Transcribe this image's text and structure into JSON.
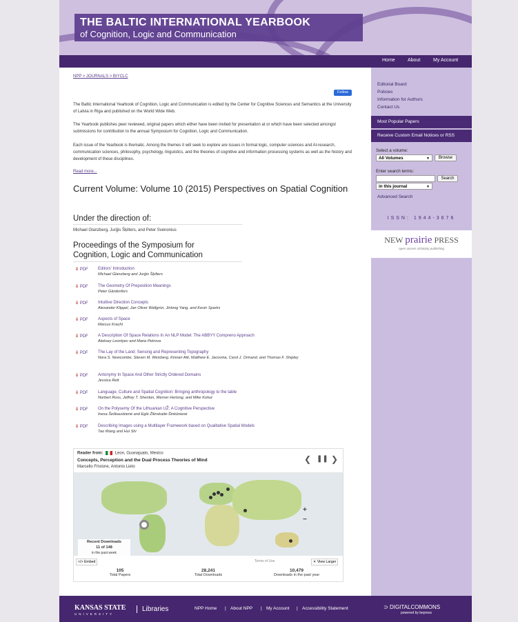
{
  "banner": {
    "title_line1": "THE BALTIC INTERNATIONAL YEARBOOK",
    "title_line2": "of Cognition, Logic and Communication"
  },
  "topnav": {
    "home": "Home",
    "about": "About",
    "account": "My Account"
  },
  "breadcrumb": "NPP > JOURNALS > BIYCLC",
  "follow_label": "Follow",
  "intro": {
    "p1": "The Baltic International Yearbook of Cognition, Logic and Communication is edited by the Center for Cognitive Sciences and Semantics at the University of Latvia in Riga and published on the World Wide Web.",
    "p2": "The Yearbook publishes peer reviewed, original papers which either have been invited for presentation at or which have been selected amongst submissions for contribution to the annual Symposium for Cognition, Logic and Communication.",
    "p3": "Each issue of the Yearbook is thematic. Among the themes it will seek to explore are issues in formal logic, computer sciences and AI-research, communication sciences, philosophy, psychology, linguistics, and the theories of cognitive and information processing systems as well as the history and development of these disciplines.",
    "read_more": "Read more..."
  },
  "current_volume": "Current Volume: Volume 10 (2015) Perspectives on Spatial Cognition",
  "direction_heading": "Under the direction of:",
  "editors": "Michael Glanzberg, Jurģis Šķilters, and Peter Svenonius",
  "proceedings_heading": "Proceedings of the Symposium for Cognition, Logic and Communication",
  "pdf_label": "PDF",
  "papers": [
    {
      "title": "Editors' Introduction",
      "authors": "Michael Glanzberg and Jurģis Šķilters"
    },
    {
      "title": "The Geometry Of Preposition Meanings",
      "authors": "Peter Gärdenfors"
    },
    {
      "title": "Intuitive Direction Concepts",
      "authors": "Alexander Klippel, Jan Oliver Wallgrün, Jinlong Yang, and Kevin Sparks"
    },
    {
      "title": "Aspects of Space",
      "authors": "Marcus Kracht"
    },
    {
      "title": "A Description Of Space Relations In An NLP Model: The ABBYY Compreno Approach",
      "authors": "Aleksey Leontyev and Maria Petrova"
    },
    {
      "title": "The Lay of the Land: Sensing and Representing Topography",
      "authors": "Nora S. Newcombe, Steven M. Weisberg, Kinnari Atit, Matthew E. Jacovina, Carol J. Ormand, and Thomas F. Shipley"
    },
    {
      "title": "Antonymy In Space And Other Strictly Ordered Domains",
      "authors": "Jessica Rett"
    },
    {
      "title": "Language, Culture and Spatial Cognition: Bringing anthropology to the table",
      "authors": "Norbert Ross, Jeffrey T. Shenton, Werner Hertzog, and Mike Kohut"
    },
    {
      "title": "On the Polysemy Of the Lithuanian UŽ: A Cognitive Perspective",
      "authors": "Inesa Šeškauskienė and Eglė Žilinskaitė-Šinkūnienė"
    },
    {
      "title": "Describing Images using a Multilayer Framework based on Qualitative Spatial Models",
      "authors": "Tao Wang and Hui Shi"
    }
  ],
  "widget": {
    "reader_label": "Reader from:",
    "reader_location": "Leon, Guanajuato, Mexico",
    "current_title": "Concepts, Perception and the Dual Process Theories of Mind",
    "current_authors": "Marcello Frixione, Antonio Lieto",
    "recent_title": "Recent Downloads",
    "recent_count": "11 of 148",
    "recent_sub": "in the past week",
    "embed": "</> Embed",
    "terms": "Terms of Use",
    "view_larger": "View Larger",
    "stats": [
      {
        "value": "105",
        "label": "Total Papers"
      },
      {
        "value": "28,241",
        "label": "Total Downloads"
      },
      {
        "value": "10,479",
        "label": "Downloads in the past year"
      }
    ]
  },
  "sidebar": {
    "links": [
      "Editorial Board",
      "Policies",
      "Information for Authors",
      "Contact Us"
    ],
    "popular": "Most Popular Papers",
    "notices": "Receive Custom Email Notices or RSS",
    "select_volume_label": "Select a volume:",
    "volume_value": "All Volumes",
    "browse": "Browse",
    "search_label": "Enter search terms:",
    "search_placeholder": "",
    "search_button": "Search",
    "scope_value": "in this journal",
    "advanced": "Advanced Search",
    "issn": "ISSN: 1944-3676",
    "npp_logo_a": "NEW ",
    "npp_logo_b": "prairie",
    "npp_logo_c": " PRESS",
    "npp_sub": "open access scholarly publishing"
  },
  "footer": {
    "ksu": "KANSAS STATE",
    "ksu_sub": "UNIVERSITY",
    "libraries": "Libraries",
    "links": [
      "NPP Home",
      "About NPP",
      "My Account",
      "Accessibility Statement"
    ],
    "dc": "DIGITALCOMMONS",
    "dc_sub": "powered by bepress"
  }
}
